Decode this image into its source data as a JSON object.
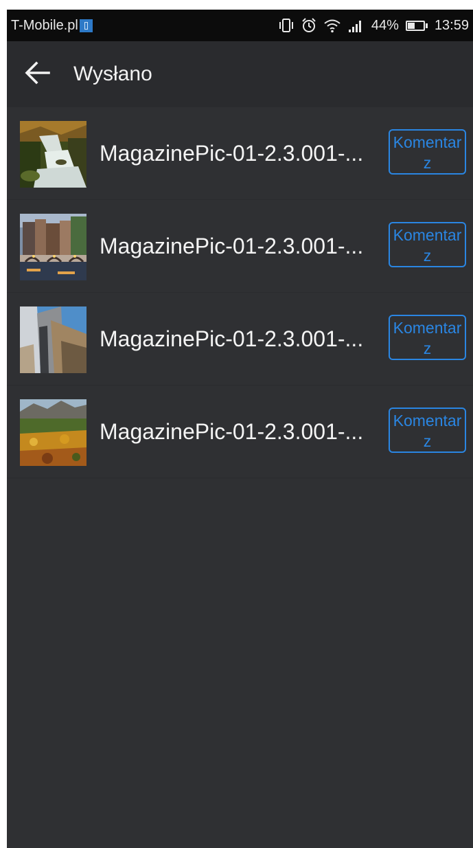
{
  "status_bar": {
    "carrier": "T-Mobile.pl",
    "battery_percent_text": "44%",
    "battery_level": 0.44,
    "time": "13:59",
    "icons": [
      "vibrate-icon",
      "alarm-icon",
      "wifi-icon",
      "signal-icon",
      "battery-icon"
    ]
  },
  "app_bar": {
    "title": "Wysłano",
    "back_icon": "arrow-left-icon"
  },
  "list": {
    "items": [
      {
        "file_name": "MagazinePic-01-2.3.001-...",
        "comment_label": "Komentarz",
        "thumbnail": "waterfall"
      },
      {
        "file_name": "MagazinePic-01-2.3.001-...",
        "comment_label": "Komentarz",
        "thumbnail": "canal-houses"
      },
      {
        "file_name": "MagazinePic-01-2.3.001-...",
        "comment_label": "Komentarz",
        "thumbnail": "metal-architecture"
      },
      {
        "file_name": "MagazinePic-01-2.3.001-...",
        "comment_label": "Komentarz",
        "thumbnail": "autumn-mountains"
      }
    ]
  },
  "colors": {
    "background": "#2f3033",
    "app_bar": "#2a2b2e",
    "status_bar": "#0c0c0c",
    "accent": "#2a86e3",
    "text": "#f4f4f4"
  }
}
